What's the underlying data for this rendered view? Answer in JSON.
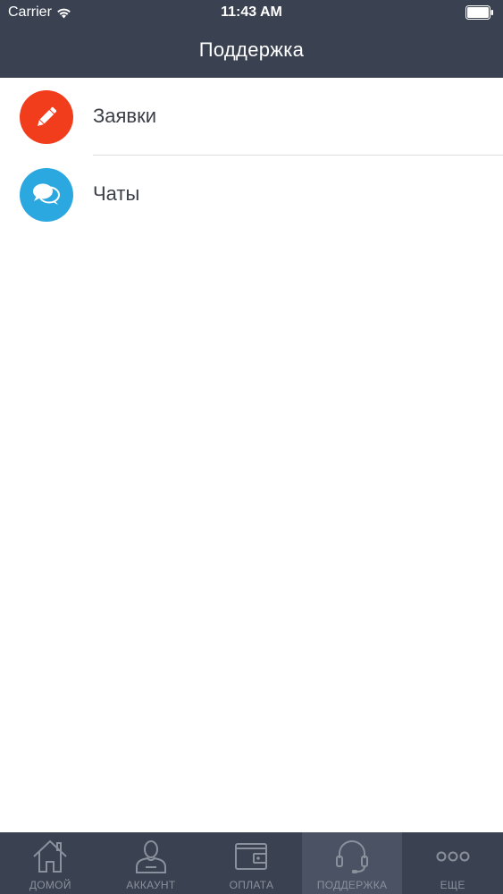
{
  "status_bar": {
    "carrier": "Carrier",
    "time": "11:43 AM"
  },
  "header": {
    "title": "Поддержка"
  },
  "menu": {
    "items": [
      {
        "label": "Заявки",
        "icon": "pencil-icon",
        "color": "#f23d1d"
      },
      {
        "label": "Чаты",
        "icon": "chat-bubbles-icon",
        "color": "#2ba8e0"
      }
    ]
  },
  "tab_bar": {
    "tabs": [
      {
        "label": "ДОМОЙ",
        "icon": "home-icon",
        "active": false
      },
      {
        "label": "АККАУНТ",
        "icon": "user-icon",
        "active": false
      },
      {
        "label": "ОПЛАТА",
        "icon": "wallet-icon",
        "active": false
      },
      {
        "label": "ПОДДЕРЖКА",
        "icon": "headset-icon",
        "active": true
      },
      {
        "label": "ЕЩЕ",
        "icon": "more-dots-icon",
        "active": false
      }
    ]
  },
  "colors": {
    "header_bg": "#3a4150",
    "tab_active_bg": "#4a5263",
    "tab_inactive": "#8a909c"
  }
}
